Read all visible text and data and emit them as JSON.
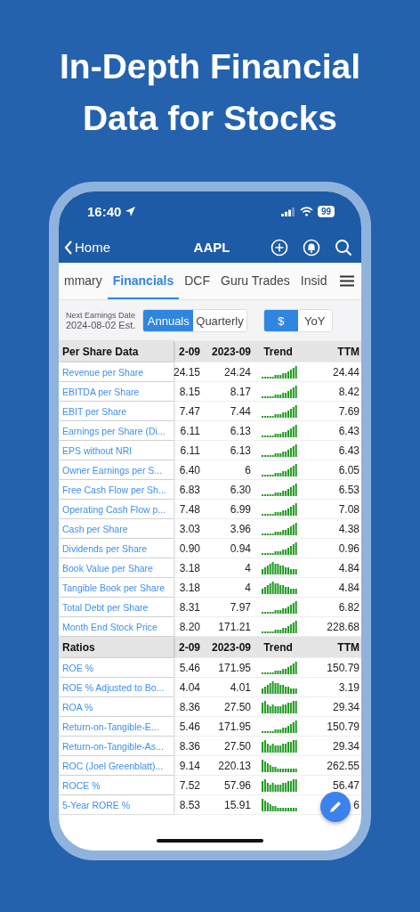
{
  "headline": [
    "In-Depth Financial",
    "Data for Stocks"
  ],
  "status_bar": {
    "time": "16:40",
    "battery": "99"
  },
  "nav": {
    "back": "Home",
    "title": "AAPL"
  },
  "tabs": [
    {
      "label": "mmary",
      "selected": false
    },
    {
      "label": "Financials",
      "selected": true
    },
    {
      "label": "DCF",
      "selected": false
    },
    {
      "label": "Guru Trades",
      "selected": false
    },
    {
      "label": "Insid",
      "selected": false
    }
  ],
  "earnings": {
    "label": "Next Earnings Date",
    "date": "2024-08-02 Est."
  },
  "period_toggle": [
    {
      "label": "Annuals",
      "selected": true
    },
    {
      "label": "Quarterly",
      "selected": false
    }
  ],
  "unit_toggle": [
    {
      "label": "$",
      "selected": true
    },
    {
      "label": "YoY",
      "selected": false
    }
  ],
  "sections": [
    {
      "title": "Per Share Data",
      "columns": [
        "2-09",
        "2023-09",
        "Trend",
        "TTM"
      ],
      "rows": [
        {
          "label": "Revenue per Share",
          "prev": "24.15",
          "cur": "24.24",
          "ttm": "24.44"
        },
        {
          "label": "EBITDA per Share",
          "prev": "8.15",
          "cur": "8.17",
          "ttm": "8.42"
        },
        {
          "label": "EBIT per Share",
          "prev": "7.47",
          "cur": "7.44",
          "ttm": "7.69"
        },
        {
          "label": "Earnings per Share (Di...",
          "prev": "6.11",
          "cur": "6.13",
          "ttm": "6.43"
        },
        {
          "label": "EPS without NRI",
          "prev": "6.11",
          "cur": "6.13",
          "ttm": "6.43"
        },
        {
          "label": "Owner Earnings per S...",
          "prev": "6.40",
          "cur": "6",
          "ttm": "6.05"
        },
        {
          "label": "Free Cash Flow per Sh...",
          "prev": "6.83",
          "cur": "6.30",
          "ttm": "6.53"
        },
        {
          "label": "Operating Cash Flow p...",
          "prev": "7.48",
          "cur": "6.99",
          "ttm": "7.08"
        },
        {
          "label": "Cash per Share",
          "prev": "3.03",
          "cur": "3.96",
          "ttm": "4.38"
        },
        {
          "label": "Dividends per Share",
          "prev": "0.90",
          "cur": "0.94",
          "ttm": "0.96"
        },
        {
          "label": "Book Value per Share",
          "prev": "3.18",
          "cur": "4",
          "ttm": "4.84"
        },
        {
          "label": "Tangible Book per Share",
          "prev": "3.18",
          "cur": "4",
          "ttm": "4.84"
        },
        {
          "label": "Total Debt per Share",
          "prev": "8.31",
          "cur": "7.97",
          "ttm": "6.82"
        },
        {
          "label": "Month End Stock Price",
          "prev": "8.20",
          "cur": "171.21",
          "ttm": "228.68"
        }
      ]
    },
    {
      "title": "Ratios",
      "columns": [
        "2-09",
        "2023-09",
        "Trend",
        "TTM"
      ],
      "rows": [
        {
          "label": "ROE %",
          "prev": "5.46",
          "cur": "171.95",
          "ttm": "150.79"
        },
        {
          "label": "ROE % Adjusted to Bo...",
          "prev": "4.04",
          "cur": "4.01",
          "ttm": "3.19"
        },
        {
          "label": "ROA %",
          "prev": "8.36",
          "cur": "27.50",
          "ttm": "29.34"
        },
        {
          "label": "Return-on-Tangible-E...",
          "prev": "5.46",
          "cur": "171.95",
          "ttm": "150.79"
        },
        {
          "label": "Return-on-Tangible-As...",
          "prev": "8.36",
          "cur": "27.50",
          "ttm": "29.34"
        },
        {
          "label": "ROC (Joel Greenblatt)...",
          "prev": "9.14",
          "cur": "220.13",
          "ttm": "262.55"
        },
        {
          "label": "ROCE %",
          "prev": "7.52",
          "cur": "57.96",
          "ttm": "56.47"
        },
        {
          "label": "5-Year RORE %",
          "prev": "8.53",
          "cur": "15.91",
          "ttm": "6"
        }
      ]
    }
  ]
}
